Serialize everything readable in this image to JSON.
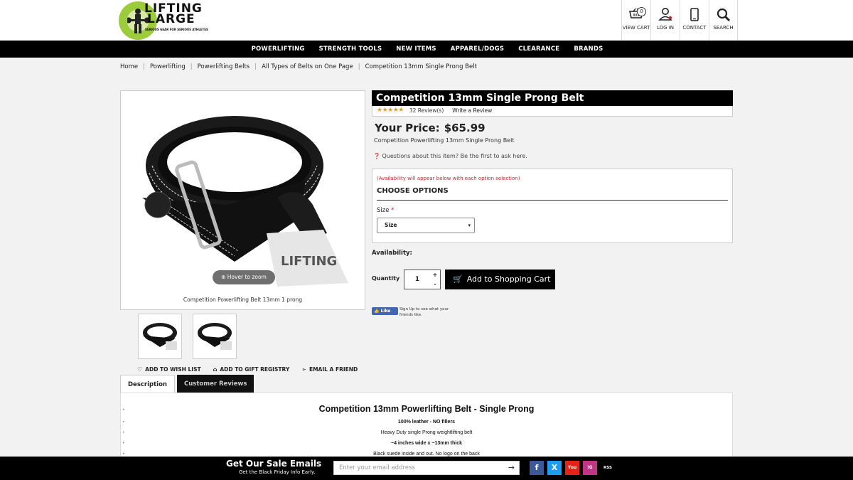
{
  "logo": {
    "line1": "LIFTING",
    "line2": "LARGE",
    "tagline": "SERIOUS GEAR FOR SERIOUS ATHLETES"
  },
  "header_icons": [
    {
      "label": "VIEW CART",
      "icon": "cart-icon",
      "badge": "0"
    },
    {
      "label": "LOG IN",
      "icon": "user-icon"
    },
    {
      "label": "CONTACT",
      "icon": "phone-icon"
    },
    {
      "label": "SEARCH",
      "icon": "search-icon"
    }
  ],
  "nav": [
    "POWERLIFTING",
    "STRENGTH TOOLS",
    "NEW ITEMS",
    "APPAREL/DOGS",
    "CLEARANCE",
    "BRANDS"
  ],
  "breadcrumb": [
    "Home",
    "Powerlifting",
    "Powerlifting Belts",
    "All Types of Belts on One Page",
    "Competition 13mm Single Prong Belt"
  ],
  "product": {
    "title": "Competition 13mm Single Prong Belt",
    "stars": "★★★★★",
    "reviews": "32 Review(s)",
    "write_review": "Write a Review",
    "price_label": "Your Price:",
    "price": "$65.99",
    "subtitle": "Competition Powerlifting 13mm Single Prong Belt",
    "questions": "Questions about this item? Be the first to ask here.",
    "zoom": "Hover to zoom",
    "image_caption": "Competition Powerlifting Belt 13mm 1 prong"
  },
  "options": {
    "availability_note": "(Availability will appear below with each option selection)",
    "heading": "CHOOSE OPTIONS",
    "size_label": "Size",
    "required_mark": "*",
    "size_selected": "Size"
  },
  "purchase": {
    "availability_label": "Availability:",
    "quantity_label": "Quantity",
    "quantity": "1",
    "plus": "+",
    "minus": "-",
    "add_to_cart": "Add to Shopping Cart"
  },
  "facebook": {
    "like": "Like",
    "text": "Sign Up to see what your friends like."
  },
  "actions": {
    "wish": "ADD TO WISH LIST",
    "gift": "ADD TO GIFT REGISTRY",
    "email": "EMAIL A FRIEND"
  },
  "tabs": [
    "Description",
    "Customer Reviews"
  ],
  "description": {
    "title": "Competition 13mm Powerlifting Belt - Single Prong",
    "lines": [
      "100% leather - NO fillers",
      "Heavy Duty single Prong weightlifting belt",
      "~4 inches wide x ~13mm thick",
      "Black suede inside and out. No logo on the back"
    ]
  },
  "footer": {
    "title": "Get Our Sale Emails",
    "subtitle": "Get the Black Friday Info Early.",
    "email_placeholder": "Enter your email address",
    "social": [
      "f",
      "X",
      "You",
      "IG",
      "RSS"
    ]
  },
  "colors": {
    "accent_black": "#000000",
    "required_red": "#c0262d",
    "star_gold": "#e8a017",
    "facebook_blue": "#4267b2"
  }
}
